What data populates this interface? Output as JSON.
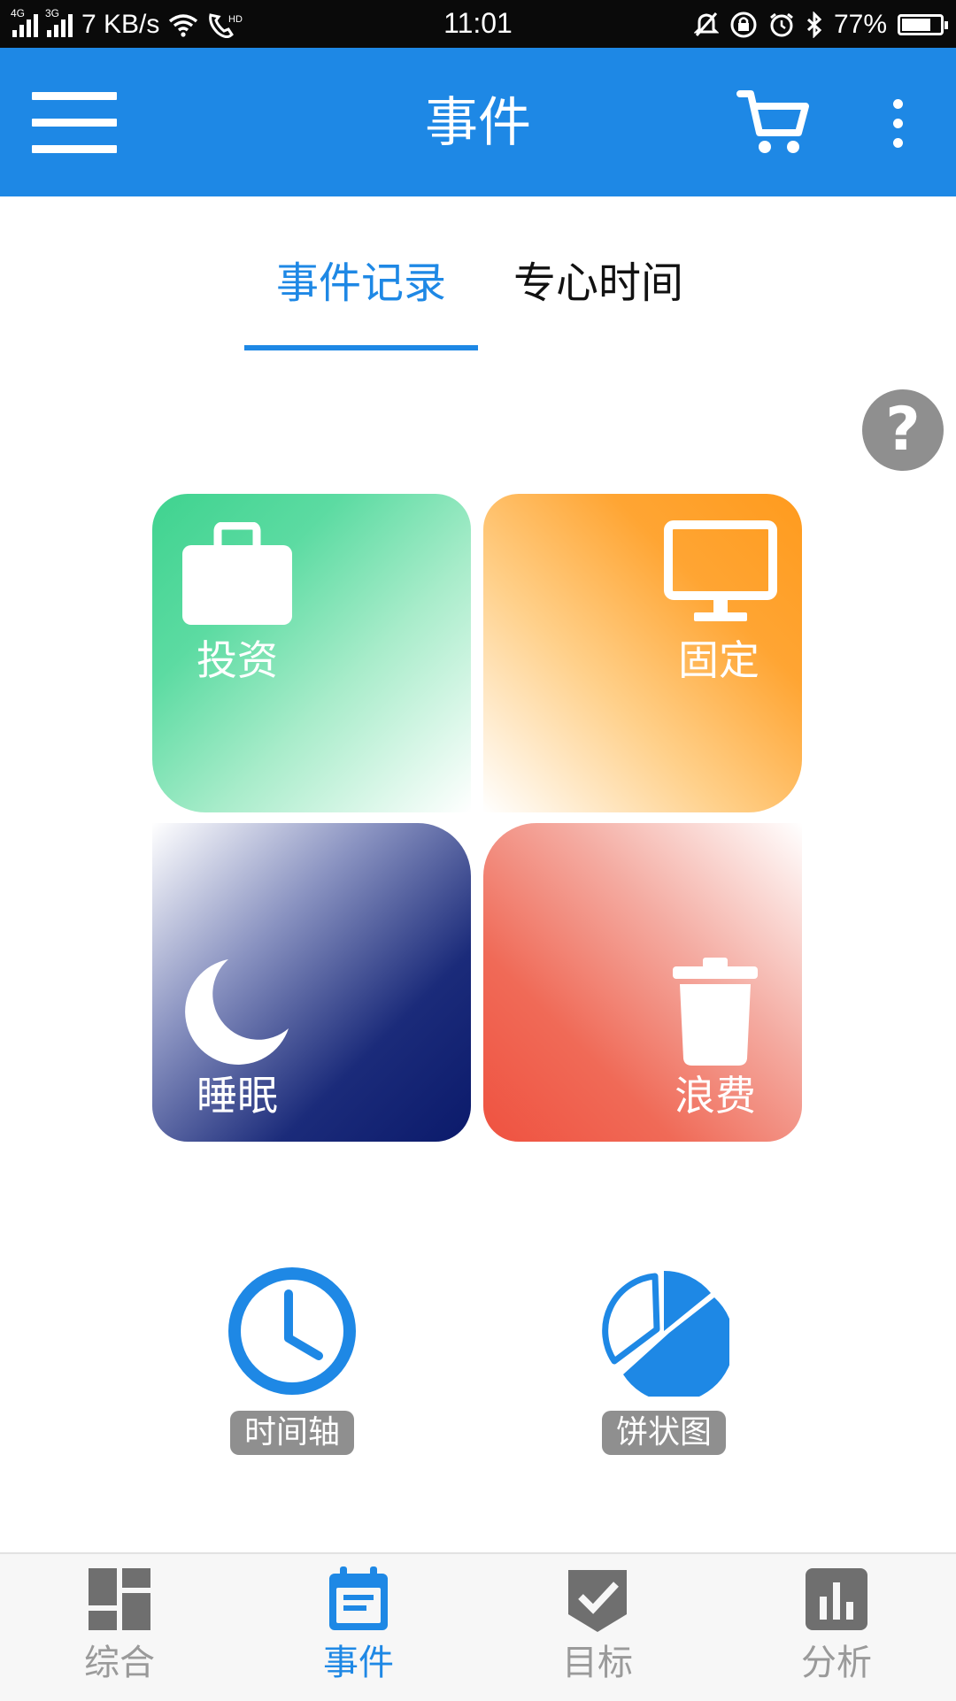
{
  "status_bar": {
    "net1": "4G",
    "net2": "3G",
    "speed": "7 KB/s",
    "time": "11:01",
    "battery": "77%",
    "battery_level": 0.77,
    "icons": [
      "signal-icon",
      "wifi-icon",
      "hd-call-icon",
      "mute-icon",
      "lock-rotation-icon",
      "alarm-icon",
      "bluetooth-icon",
      "battery-icon"
    ]
  },
  "app_bar": {
    "title": "事件",
    "icons": [
      "menu-icon",
      "cart-icon",
      "more-vert-icon"
    ],
    "color": "#1e88e5"
  },
  "tabs": {
    "items": [
      "事件记录",
      "专心时间"
    ],
    "active_index": 0
  },
  "help": {
    "label": "?"
  },
  "categories": [
    {
      "label": "投资",
      "icon": "briefcase-icon",
      "color": "#3fd38f"
    },
    {
      "label": "固定",
      "icon": "monitor-icon",
      "color": "#ff9b1e"
    },
    {
      "label": "睡眠",
      "icon": "moon-icon",
      "color": "#0b1a6b"
    },
    {
      "label": "浪费",
      "icon": "trash-icon",
      "color": "#ef5240"
    }
  ],
  "tools": [
    {
      "label": "时间轴",
      "icon": "clock-icon"
    },
    {
      "label": "饼状图",
      "icon": "pie-chart-icon"
    }
  ],
  "bottom_nav": {
    "items": [
      {
        "label": "综合",
        "icon": "dashboard-icon"
      },
      {
        "label": "事件",
        "icon": "calendar-icon"
      },
      {
        "label": "目标",
        "icon": "goal-check-icon"
      },
      {
        "label": "分析",
        "icon": "bar-chart-icon"
      }
    ],
    "active_index": 1,
    "active_color": "#1e88e5",
    "inactive_color": "#9a9a9a"
  }
}
